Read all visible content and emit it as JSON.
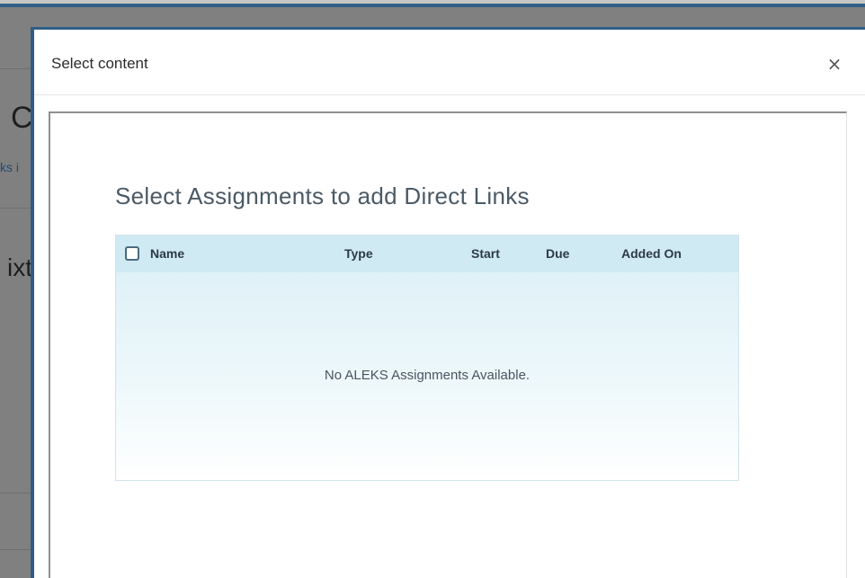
{
  "background": {
    "fragment_big": "C",
    "fragment_small": "ks i",
    "fragment_med": "ixt"
  },
  "modal": {
    "title": "Select content",
    "close_glyph": "×",
    "heading": "Select Assignments to add Direct Links",
    "table": {
      "columns": [
        "Name",
        "Type",
        "Start",
        "Due",
        "Added On"
      ],
      "empty_message": "No ALEKS Assignments Available."
    }
  },
  "colors": {
    "accent_border": "#2e5d86",
    "header_row": "#cfeaf3"
  }
}
